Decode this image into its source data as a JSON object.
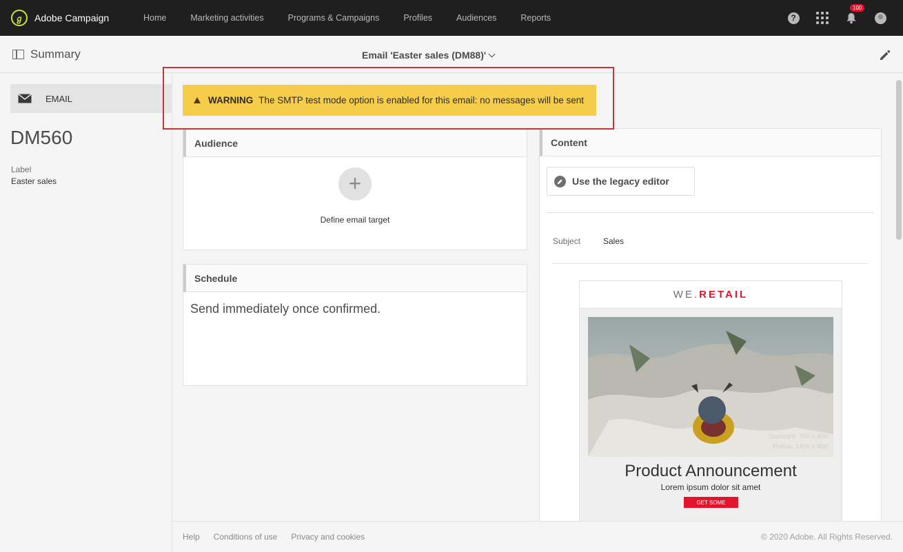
{
  "app": {
    "name": "Adobe Campaign",
    "logo_glyph": "ℊ"
  },
  "nav": [
    {
      "label": "Home"
    },
    {
      "label": "Marketing activities"
    },
    {
      "label": "Programs & Campaigns"
    },
    {
      "label": "Profiles"
    },
    {
      "label": "Audiences"
    },
    {
      "label": "Reports"
    }
  ],
  "top_icons": {
    "help_glyph": "?",
    "notifications_count": "100"
  },
  "header": {
    "summary_label": "Summary",
    "title": "Email 'Easter sales (DM88)'"
  },
  "sidebar": {
    "type_label": "EMAIL",
    "delivery_id": "DM560",
    "label_key": "Label",
    "label_value": "Easter sales"
  },
  "warning": {
    "title": "WARNING",
    "text": "The SMTP test mode option is enabled for this email: no messages will be sent"
  },
  "audience": {
    "title": "Audience",
    "add_glyph": "+",
    "define_target": "Define email target"
  },
  "schedule": {
    "title": "Schedule",
    "text": "Send immediately once confirmed."
  },
  "content": {
    "title": "Content",
    "legacy_button": "Use the legacy editor",
    "subject_key": "Subject",
    "subject_value": "Sales",
    "preview": {
      "logo_we": "WE.",
      "logo_retail": "RETAIL",
      "image_caption_1": "Standard: 700 x 400",
      "image_caption_2": "Retina: 1400 x 800",
      "headline": "Product Announcement",
      "lorem": "Lorem ipsum dolor sit amet",
      "cta": "GET SOME"
    }
  },
  "footer": {
    "links": [
      {
        "label": "Help"
      },
      {
        "label": "Conditions of use"
      },
      {
        "label": "Privacy and cookies"
      }
    ],
    "copyright": "© 2020 Adobe. All Rights Reserved."
  },
  "colors": {
    "topbar": "#1f1f1f",
    "brand_accent": "#cce82c",
    "warning_bg": "#f6cc4b",
    "highlight_outline": "#d0302e",
    "retail_red": "#e3132b"
  }
}
